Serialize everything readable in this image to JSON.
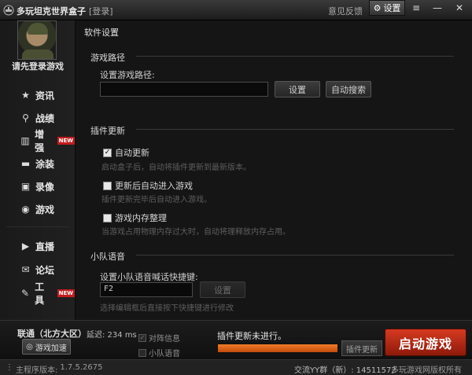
{
  "titlebar": {
    "app_title": "多玩坦克世界盒子",
    "login_link": "[登录]",
    "feedback": "意见反馈",
    "settings": "设置"
  },
  "sidebar": {
    "login_prompt": "请先登录游戏",
    "items": [
      {
        "label": "资讯",
        "icon": "star-icon"
      },
      {
        "label": "战绩",
        "icon": "search-icon"
      },
      {
        "label": "增强",
        "icon": "chart-icon",
        "badge": "NEW"
      },
      {
        "label": "涂装",
        "icon": "tank-icon"
      },
      {
        "label": "录像",
        "icon": "film-icon"
      },
      {
        "label": "游戏",
        "icon": "gamepad-icon"
      },
      {
        "label": "直播",
        "icon": "play-icon"
      },
      {
        "label": "论坛",
        "icon": "chat-icon"
      },
      {
        "label": "工具",
        "icon": "wrench-icon",
        "badge": "NEW"
      }
    ]
  },
  "main": {
    "page_title": "软件设置",
    "game_path": {
      "title": "游戏路径",
      "label": "设置游戏路径:",
      "value": "",
      "set_button": "设置",
      "auto_search_button": "自动搜索"
    },
    "plugin_update": {
      "title": "插件更新",
      "options": [
        {
          "label": "自动更新",
          "checked": true,
          "hint": "启动盒子后，自动将插件更新到最新版本。"
        },
        {
          "label": "更新后自动进入游戏",
          "checked": false,
          "hint": "插件更新完毕后自动进入游戏。"
        },
        {
          "label": "游戏内存整理",
          "checked": false,
          "hint": "当游戏占用物理内存过大时，自动将理释放内存占用。"
        }
      ]
    },
    "squad_voice": {
      "title": "小队语音",
      "label": "设置小队语音喊话快捷键:",
      "hotkey": "F2",
      "set_button": "设置",
      "hint": "选择编辑框后直接按下快捷键进行修改"
    }
  },
  "bottom": {
    "server": "联通（北方大区）",
    "latency": "延迟: 234 ms",
    "accelerate_button": "游戏加速",
    "options": [
      {
        "label": "对阵信息",
        "checked": true
      },
      {
        "label": "小队语音",
        "checked": false
      }
    ],
    "update_status": "插件更新未进行。",
    "progress": 1.0,
    "plugin_button": "插件更新",
    "launch_button": "启动游戏"
  },
  "statusbar": {
    "version_label": "主程序版本:",
    "version": "1.7.5.2675",
    "qq_group": "交流YY群（新）: 14511572",
    "copyright": "多玩游戏网版权所有"
  },
  "colors": {
    "accent": "#d63a20",
    "progress": "#f07d28"
  }
}
